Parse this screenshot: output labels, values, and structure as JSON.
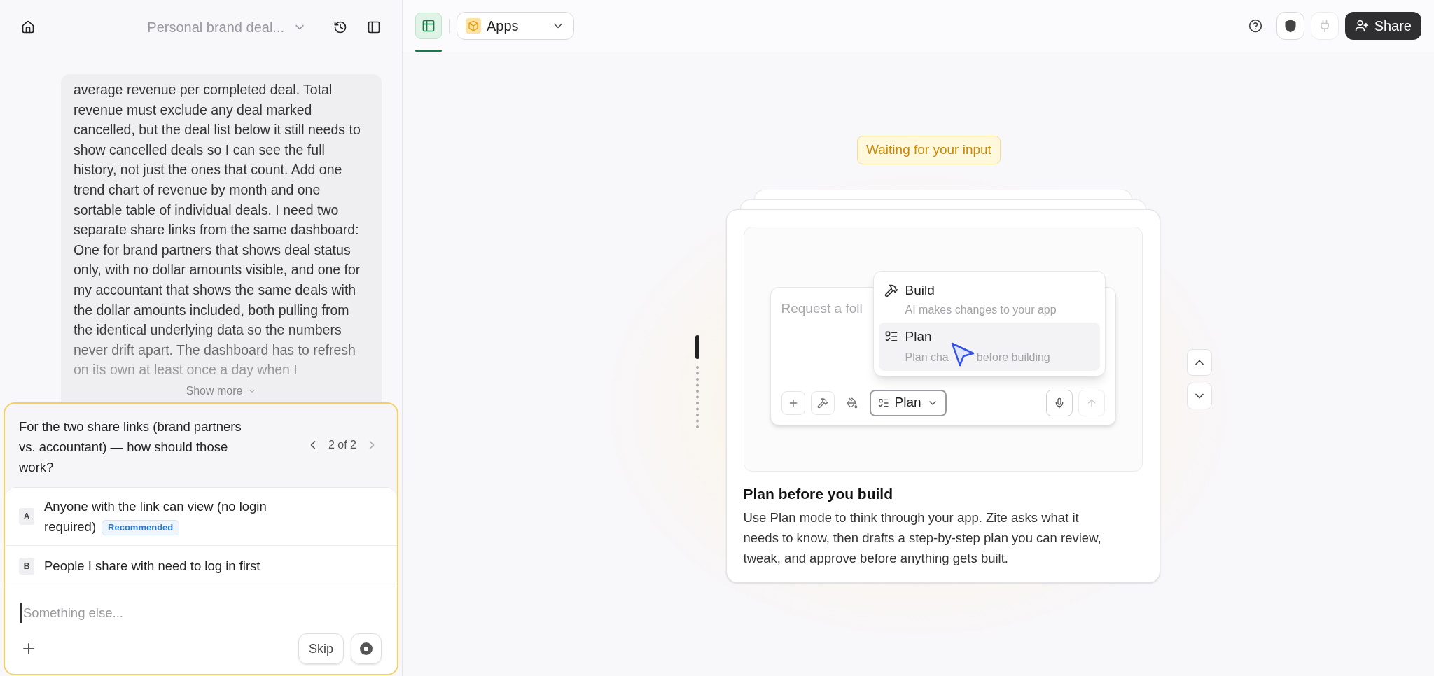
{
  "sidebar": {
    "title": "Personal brand deal...",
    "message": {
      "text": "average revenue per completed deal. Total revenue must exclude any deal marked cancelled, but the deal list below it still needs to show cancelled deals so I can see the full history, not just the ones that count. Add one trend chart of revenue by month and one sortable table of individual deals. I need two separate share links from the same dashboard: One for brand partners that shows deal status only, with no dollar amounts visible, and one for my accountant that shows the same deals with the dollar amounts included, both pulling from the identical underlying data so the numbers never drift apart. The dashboard has to refresh on its own at least once a day when I",
      "show_more": "Show more"
    },
    "question": {
      "text": "For the two share links (brand partners vs. accountant) — how should those work?",
      "pager": "2 of 2",
      "options": [
        {
          "letter": "A",
          "label": "Anyone with the link can view (no login required)",
          "badge": "Recommended"
        },
        {
          "letter": "B",
          "label": "People I share with need to log in first"
        }
      ],
      "input": {
        "placeholder": "Something else..."
      },
      "skip": "Skip"
    }
  },
  "toolbar": {
    "view_tab": {
      "selected": true
    },
    "app_selector": "Apps",
    "share": "Share"
  },
  "canvas": {
    "status": "Waiting for your input",
    "tip": {
      "composer": {
        "placeholder": "Request a foll",
        "mode": "Plan"
      },
      "menu": [
        {
          "kind": "build",
          "label": "Build",
          "description": [
            "AI makes changes to your app"
          ],
          "selected": false
        },
        {
          "kind": "plan",
          "label": "Plan",
          "description": [
            "Plan cha",
            "before building"
          ],
          "selected": true
        }
      ],
      "title": "Plan before you build",
      "body": "Use Plan mode to think through your app. Zite asks what it needs to know, then drafts a step-by-step plan you can review, tweak, and approve before anything gets built."
    }
  }
}
